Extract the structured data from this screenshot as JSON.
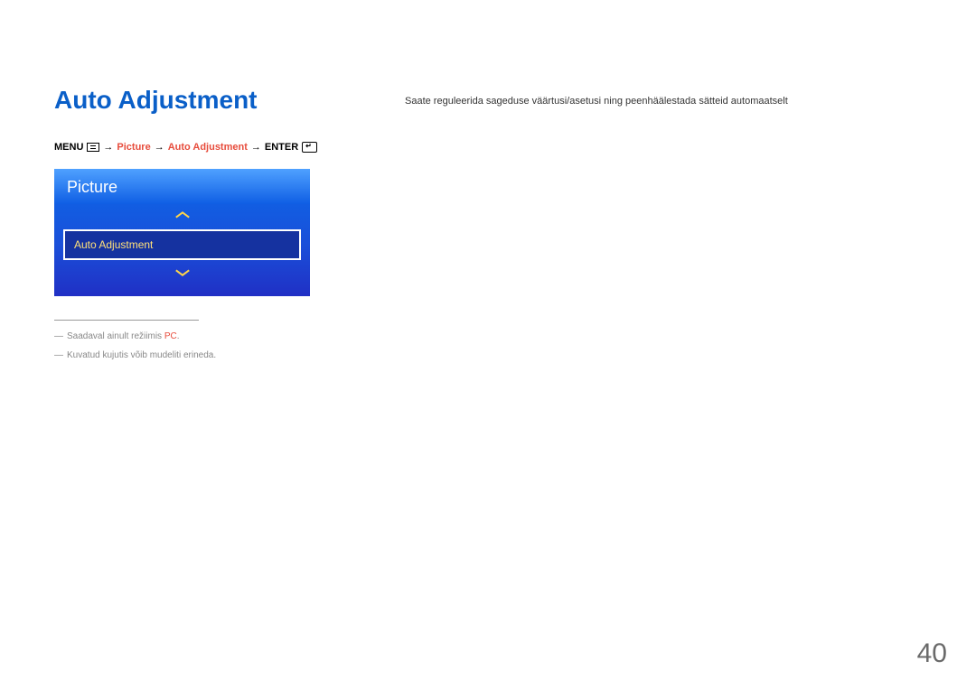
{
  "title": "Auto Adjustment",
  "body_text": "Saate reguleerida sageduse väärtusi/asetusi ning peenhäälestada sätteid automaatselt",
  "breadcrumb": {
    "menu_label": "MENU",
    "arrow": "→",
    "step1": "Picture",
    "step2": "Auto Adjustment",
    "enter_label": "ENTER"
  },
  "widget": {
    "header": "Picture",
    "selected_item": "Auto Adjustment"
  },
  "footnotes": {
    "note1_prefix": "Saadaval ainult režiimis ",
    "note1_highlight": "PC",
    "note1_suffix": ".",
    "note2": "Kuvatud kujutis võib mudeliti erineda."
  },
  "page_number": "40"
}
